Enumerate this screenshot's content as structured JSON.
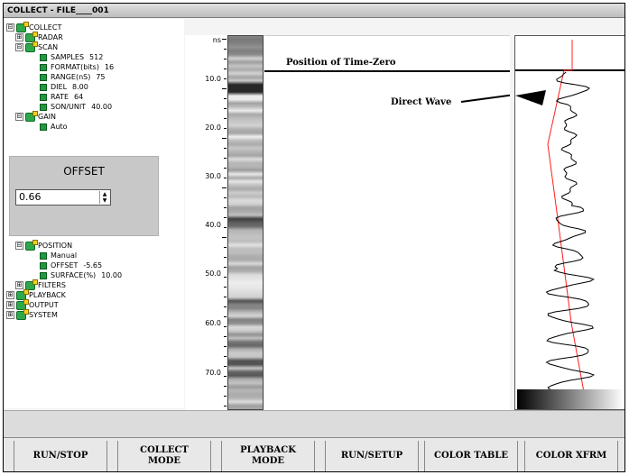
{
  "window": {
    "title": "COLLECT - FILE____001"
  },
  "tree": {
    "nodes": [
      {
        "label": "COLLECT",
        "expander": "⊟",
        "kind": "folder"
      },
      {
        "label": "RADAR",
        "expander": "⊞",
        "kind": "folder"
      },
      {
        "label": "SCAN",
        "expander": "⊟",
        "kind": "folder"
      },
      {
        "label": "SAMPLES",
        "value": "512",
        "kind": "param"
      },
      {
        "label": "FORMAT(bits)",
        "value": "16",
        "kind": "param"
      },
      {
        "label": "RANGE(nS)",
        "value": "75",
        "kind": "param"
      },
      {
        "label": "DIEL",
        "value": "8.00",
        "kind": "param"
      },
      {
        "label": "RATE",
        "value": "64",
        "kind": "param"
      },
      {
        "label": "SON/UNIT",
        "value": "40.00",
        "kind": "param"
      },
      {
        "label": "GAIN",
        "expander": "⊟",
        "kind": "folder"
      },
      {
        "label": "Auto",
        "value": "",
        "kind": "param"
      },
      {
        "label": "POSITION",
        "expander": "⊟",
        "kind": "folder"
      },
      {
        "label": "Manual",
        "value": "",
        "kind": "param"
      },
      {
        "label": "OFFSET",
        "value": "-5.65",
        "kind": "param"
      },
      {
        "label": "SURFACE(%)",
        "value": "10.00",
        "kind": "param"
      },
      {
        "label": "FILTERS",
        "expander": "⊞",
        "kind": "folder"
      },
      {
        "label": "PLAYBACK",
        "expander": "⊞",
        "kind": "folder"
      },
      {
        "label": "OUTPUT",
        "expander": "⊞",
        "kind": "folder"
      },
      {
        "label": "SYSTEM",
        "expander": "⊞",
        "kind": "folder"
      }
    ]
  },
  "offset_panel": {
    "title": "OFFSET",
    "value": "0.66",
    "up_glyph": "▲",
    "down_glyph": "▼"
  },
  "ruler": {
    "unit": "ns",
    "labels": [
      "10.0",
      "20.0",
      "30.0",
      "40.0",
      "50.0",
      "60.0",
      "70.0"
    ]
  },
  "annotations": {
    "time_zero": "Position of Time-Zero",
    "direct_wave": "Direct Wave"
  },
  "toolbar": {
    "buttons": [
      "RUN/STOP",
      "COLLECT\nMODE",
      "PLAYBACK\nMODE",
      "RUN/SETUP",
      "COLOR TABLE",
      "COLOR XFRM"
    ]
  },
  "colors": {
    "gain_curve": "#ff2020",
    "waveform": "#000000",
    "folder": "#2ea84a"
  }
}
